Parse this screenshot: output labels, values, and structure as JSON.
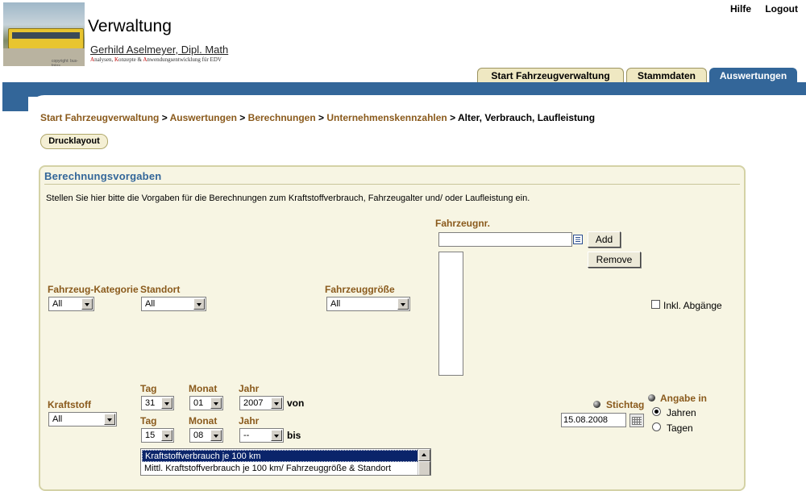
{
  "header": {
    "app_title": "Verwaltung",
    "author": "Gerhild Aselmeyer, Dipl. Math",
    "subline": {
      "a": "A",
      "a_rest": "nalysen, ",
      "k": "K",
      "k_rest": "onzepte & ",
      "an": "A",
      "an_rest": "nwendungsentwicklung für EDV"
    },
    "logo_caption": "copyright: bus-fotos"
  },
  "toplinks": {
    "help": "Hilfe",
    "logout": "Logout"
  },
  "tabs": [
    {
      "label": "Start Fahrzeugverwaltung",
      "active": false
    },
    {
      "label": "Stammdaten",
      "active": false
    },
    {
      "label": "Auswertungen",
      "active": true
    }
  ],
  "breadcrumb": {
    "items": [
      "Start Fahrzeugverwaltung",
      "Auswertungen",
      "Berechnungen",
      "Unternehmenskennzahlen"
    ],
    "separator": ">",
    "current": "Alter, Verbrauch, Laufleistung"
  },
  "print_button": "Drucklayout",
  "panel": {
    "title": "Berechnungsvorgaben",
    "description": "Stellen Sie hier bitte die Vorgaben für die Berechnungen zum Kraftstoffverbrauch, Fahrzeugalter und/ oder Laufleistung ein."
  },
  "fields": {
    "vehicle_no": {
      "label": "Fahrzeugnr.",
      "value": "",
      "add": "Add",
      "remove": "Remove"
    },
    "category": {
      "label": "Fahrzeug-Kategorie",
      "value": "All"
    },
    "location": {
      "label": "Standort",
      "value": "All"
    },
    "size": {
      "label": "Fahrzeuggröße",
      "value": "All"
    },
    "include_retired": {
      "label": "Inkl. Abgänge",
      "checked": false
    },
    "fuel": {
      "label": "Kraftstoff",
      "value": "All"
    },
    "from": {
      "day_label": "Tag",
      "month_label": "Monat",
      "year_label": "Jahr",
      "day": "31",
      "month": "01",
      "year": "2007",
      "suffix": "von"
    },
    "to": {
      "day_label": "Tag",
      "month_label": "Monat",
      "year_label": "Jahr",
      "day": "15",
      "month": "08",
      "year": "--",
      "suffix": "bis"
    },
    "reference_date": {
      "label": "Stichtag",
      "value": "15.08.2008"
    },
    "unit": {
      "label": "Angabe in",
      "options": [
        "Jahren",
        "Tagen"
      ],
      "selected": "Jahren"
    }
  },
  "calculations": [
    "Kraftstoffverbrauch je 100 km",
    "Mittl. Kraftstoffverbrauch je 100 km/ Fahrzeuggröße & Standort"
  ],
  "colors": {
    "blue": "#336699",
    "brown": "#8a5a1c",
    "panel": "#f7f5e3",
    "tab": "#efe8c2"
  }
}
